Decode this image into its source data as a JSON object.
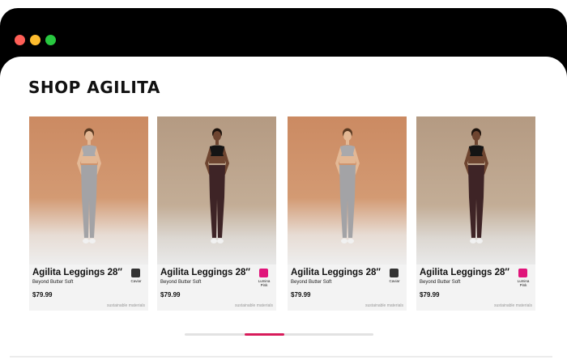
{
  "window": {
    "dots": [
      {
        "color": "#ff5f57",
        "name": "close"
      },
      {
        "color": "#febc2e",
        "name": "minimize"
      },
      {
        "color": "#28c840",
        "name": "zoom"
      }
    ]
  },
  "page": {
    "title": "SHOP AGILITA"
  },
  "products": [
    {
      "name": "Agilita Leggings 28″",
      "subtitle": "Beyond Butter Soft",
      "price": "$79.99",
      "tag": "sustainable materials",
      "swatch_color": "#333333",
      "swatch_label": "Caviar",
      "photo": "warm",
      "model": "light"
    },
    {
      "name": "Agilita Leggings 28″",
      "subtitle": "Beyond Butter Soft",
      "price": "$79.99",
      "tag": "sustainable materials",
      "swatch_color": "#e0147a",
      "swatch_label": "Lumina Pink",
      "photo": "cool",
      "model": "dark"
    },
    {
      "name": "Agilita Leggings 28″",
      "subtitle": "Beyond Butter Soft",
      "price": "$79.99",
      "tag": "sustainable materials",
      "swatch_color": "#333333",
      "swatch_label": "Caviar",
      "photo": "warm",
      "model": "light"
    },
    {
      "name": "Agilita Leggings 28″",
      "subtitle": "Beyond Butter Soft",
      "price": "$79.99",
      "tag": "sustainable materials",
      "swatch_color": "#e0147a",
      "swatch_label": "Lumina Pink",
      "photo": "cool",
      "model": "dark"
    }
  ],
  "carousel": {
    "accent_color": "#d81b5a",
    "position": 0.4
  }
}
